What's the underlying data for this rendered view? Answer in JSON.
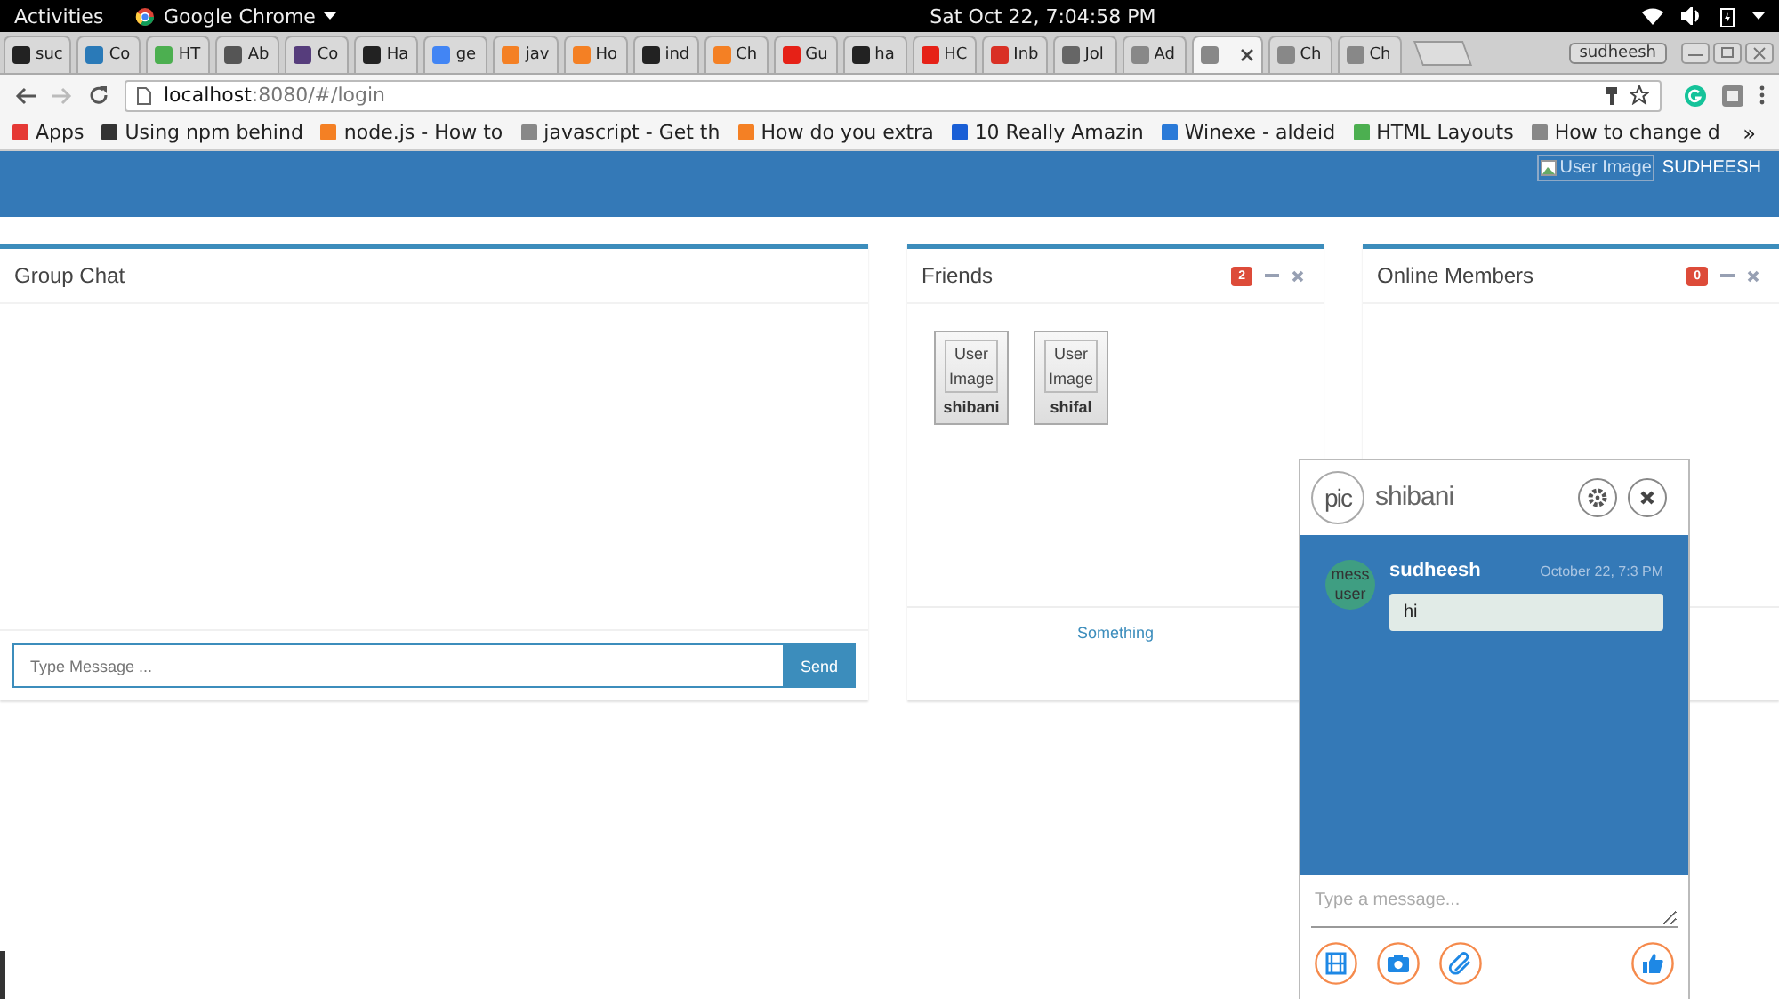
{
  "system_bar": {
    "activities": "Activities",
    "app": "Google Chrome",
    "clock": "Sat Oct 22,  7:04:58 PM"
  },
  "browser": {
    "tabs": [
      {
        "title": "suc",
        "selected": false,
        "color": "#222222"
      },
      {
        "title": "Co",
        "selected": false,
        "color": "#2a7ab8"
      },
      {
        "title": "HT",
        "selected": false,
        "color": "#4caf50"
      },
      {
        "title": "Ab",
        "selected": false,
        "color": "#555555"
      },
      {
        "title": "Co",
        "selected": false,
        "color": "#563d7c"
      },
      {
        "title": "Ha",
        "selected": false,
        "color": "#222222"
      },
      {
        "title": "ge",
        "selected": false,
        "color": "#4285f4"
      },
      {
        "title": "jav",
        "selected": false,
        "color": "#f48024"
      },
      {
        "title": "Ho",
        "selected": false,
        "color": "#f48024"
      },
      {
        "title": "ind",
        "selected": false,
        "color": "#222222"
      },
      {
        "title": "Ch",
        "selected": false,
        "color": "#f48024"
      },
      {
        "title": "Gu",
        "selected": false,
        "color": "#e62117"
      },
      {
        "title": "ha",
        "selected": false,
        "color": "#222222"
      },
      {
        "title": "HC",
        "selected": false,
        "color": "#e62117"
      },
      {
        "title": "Inb",
        "selected": false,
        "color": "#d93025"
      },
      {
        "title": "Jol",
        "selected": false,
        "color": "#666666"
      },
      {
        "title": "Ad",
        "selected": false,
        "color": "#888888"
      },
      {
        "selected": true,
        "color": "#888888"
      },
      {
        "title": "Ch",
        "selected": false,
        "color": "#888888"
      },
      {
        "title": "Ch",
        "selected": false,
        "color": "#888888"
      }
    ],
    "profile": "sudheesh",
    "url_host": "localhost",
    "url_rest": ":8080/#/login",
    "bookmarks": [
      {
        "title": "Apps",
        "color": "#e53935"
      },
      {
        "title": "Using npm behind",
        "color": "#333333"
      },
      {
        "title": "node.js - How to",
        "color": "#f48024"
      },
      {
        "title": "javascript - Get th",
        "color": "#888888"
      },
      {
        "title": "How do you extra",
        "color": "#f48024"
      },
      {
        "title": "10 Really Amazin",
        "color": "#1a5fd6"
      },
      {
        "title": "Winexe - aldeid",
        "color": "#2a7ad8"
      },
      {
        "title": "HTML Layouts",
        "color": "#4caf50"
      },
      {
        "title": "How to change d",
        "color": "#888888"
      }
    ],
    "bookmarks_overflow": "»"
  },
  "app": {
    "header": {
      "user_image_alt": "User Image",
      "user_name": "SUDHEESH"
    },
    "group_chat": {
      "title": "Group Chat",
      "placeholder": "Type Message ...",
      "send": "Send"
    },
    "friends": {
      "title": "Friends",
      "count": "2",
      "items": [
        {
          "image_alt": "User Image",
          "name": "shibani"
        },
        {
          "image_alt": "User Image",
          "name": "shifal"
        }
      ],
      "footer": "Something"
    },
    "online_members": {
      "title": "Online Members",
      "count": "0"
    },
    "chat_window": {
      "avatar_alt": "pic",
      "name": "shibani",
      "messages": [
        {
          "avatar_alt": "mess user",
          "sender": "sudheesh",
          "time": "October 22, 7:3 PM",
          "text": "hi"
        }
      ],
      "placeholder": "Type a message..."
    }
  }
}
